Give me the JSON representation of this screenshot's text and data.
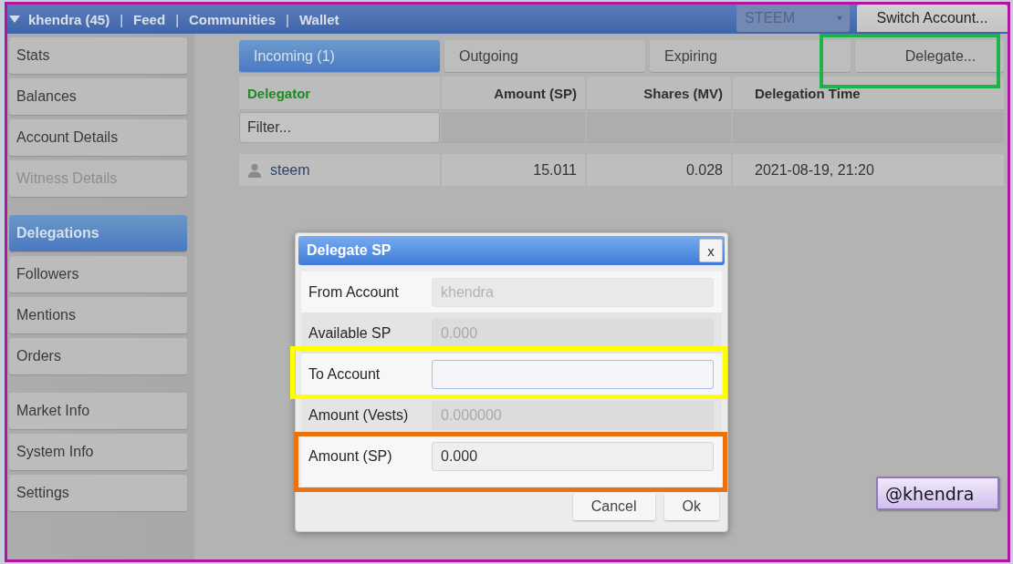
{
  "top_bar": {
    "items": [
      {
        "kind": "account",
        "label": "khendra (45)"
      },
      {
        "kind": "separator",
        "label": "|"
      },
      {
        "kind": "link",
        "label": "Feed"
      },
      {
        "kind": "separator",
        "label": "|"
      },
      {
        "kind": "link",
        "label": "Communities"
      },
      {
        "kind": "separator",
        "label": "|"
      },
      {
        "kind": "link",
        "label": "Wallet"
      }
    ],
    "chain_select": {
      "value": "STEEM"
    },
    "switch_account": {
      "label": "Switch Account..."
    }
  },
  "sidebar": {
    "groups": [
      {
        "items": [
          {
            "label": "Stats",
            "selected": false,
            "disabled": false
          },
          {
            "label": "Balances",
            "selected": false,
            "disabled": false
          },
          {
            "label": "Account Details",
            "selected": false,
            "disabled": false
          },
          {
            "label": "Witness Details",
            "selected": false,
            "disabled": true
          }
        ]
      },
      {
        "items": [
          {
            "label": "Delegations",
            "selected": true,
            "disabled": false
          },
          {
            "label": "Followers",
            "selected": false,
            "disabled": false
          },
          {
            "label": "Mentions",
            "selected": false,
            "disabled": false
          },
          {
            "label": "Orders",
            "selected": false,
            "disabled": false
          }
        ]
      },
      {
        "items": [
          {
            "label": "Market Info",
            "selected": false,
            "disabled": false
          },
          {
            "label": "System Info",
            "selected": false,
            "disabled": false
          },
          {
            "label": "Settings",
            "selected": false,
            "disabled": false
          }
        ]
      }
    ]
  },
  "tabs": [
    {
      "label": "Incoming (1)",
      "selected": true
    },
    {
      "label": "Outgoing",
      "selected": false
    },
    {
      "label": "Expiring",
      "selected": false
    }
  ],
  "delegate_button": {
    "label": "Delegate...",
    "highlight": {
      "color": "#1fb24a"
    }
  },
  "table": {
    "columns": [
      {
        "label": "Delegator",
        "kind": "text",
        "sorted": true
      },
      {
        "label": "Amount (SP)",
        "kind": "number",
        "sorted": false
      },
      {
        "label": "Shares (MV)",
        "kind": "number",
        "sorted": false
      },
      {
        "label": "Delegation Time",
        "kind": "text",
        "sorted": false
      }
    ],
    "filter": {
      "placeholder": "Filter..."
    },
    "rows": [
      {
        "cells": [
          {
            "kind": "account",
            "text": "steem"
          },
          {
            "kind": "text",
            "text": "15.011"
          },
          {
            "kind": "text",
            "text": "0.028"
          },
          {
            "kind": "text",
            "text": "2021-08-19, 21:20"
          }
        ]
      }
    ]
  },
  "dialog": {
    "title": "Delegate SP",
    "close": "x",
    "fields": [
      {
        "label": "From Account",
        "value": "khendra",
        "disabled": true,
        "focused": false
      },
      {
        "label": "Available SP",
        "value": "0.000",
        "disabled": true,
        "focused": false
      },
      {
        "label": "To Account",
        "disabled": false,
        "focused": true,
        "highlight": {
          "color": "#ffff00"
        }
      },
      {
        "label": "Amount (Vests)",
        "value": "0.000000",
        "disabled": true,
        "focused": false
      },
      {
        "label": "Amount (SP)",
        "value": "0.000",
        "disabled": false,
        "focused": false,
        "highlight": {
          "color": "#e8730f"
        }
      }
    ],
    "buttons": [
      {
        "label": "Cancel"
      },
      {
        "label": "Ok"
      }
    ]
  },
  "signature": {
    "text": "@khendra"
  }
}
